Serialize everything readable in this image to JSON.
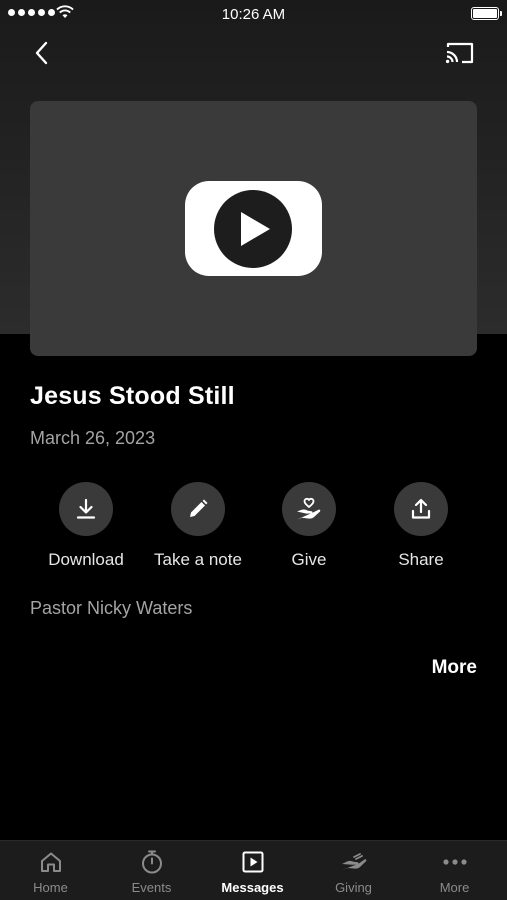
{
  "status_bar": {
    "time": "10:26 AM"
  },
  "colors": {
    "background": "#000000",
    "card": "#3a3a3b",
    "muted_text": "#a4a4a4",
    "tab_bar": "#1c1c1d",
    "active_tab": "#ffffff",
    "inactive_tab": "#8b8b8b"
  },
  "nav": {
    "back_icon": "chevron-left-icon",
    "cast_icon": "cast-icon"
  },
  "video": {
    "icon": "youtube-play-icon"
  },
  "message": {
    "title": "Jesus Stood Still",
    "date": "March 26, 2023",
    "speaker": "Pastor Nicky Waters",
    "more_label": "More"
  },
  "actions": [
    {
      "label": "Download",
      "icon": "download-icon"
    },
    {
      "label": "Take a note",
      "icon": "pencil-icon"
    },
    {
      "label": "Give",
      "icon": "giving-hand-heart-icon"
    },
    {
      "label": "Share",
      "icon": "share-icon"
    }
  ],
  "tabs": [
    {
      "label": "Home",
      "icon": "home-icon",
      "active": false
    },
    {
      "label": "Events",
      "icon": "stopwatch-icon",
      "active": false
    },
    {
      "label": "Messages",
      "icon": "play-square-icon",
      "active": true
    },
    {
      "label": "Giving",
      "icon": "giving-hand-icon",
      "active": false
    },
    {
      "label": "More",
      "icon": "ellipsis-icon",
      "active": false
    }
  ]
}
